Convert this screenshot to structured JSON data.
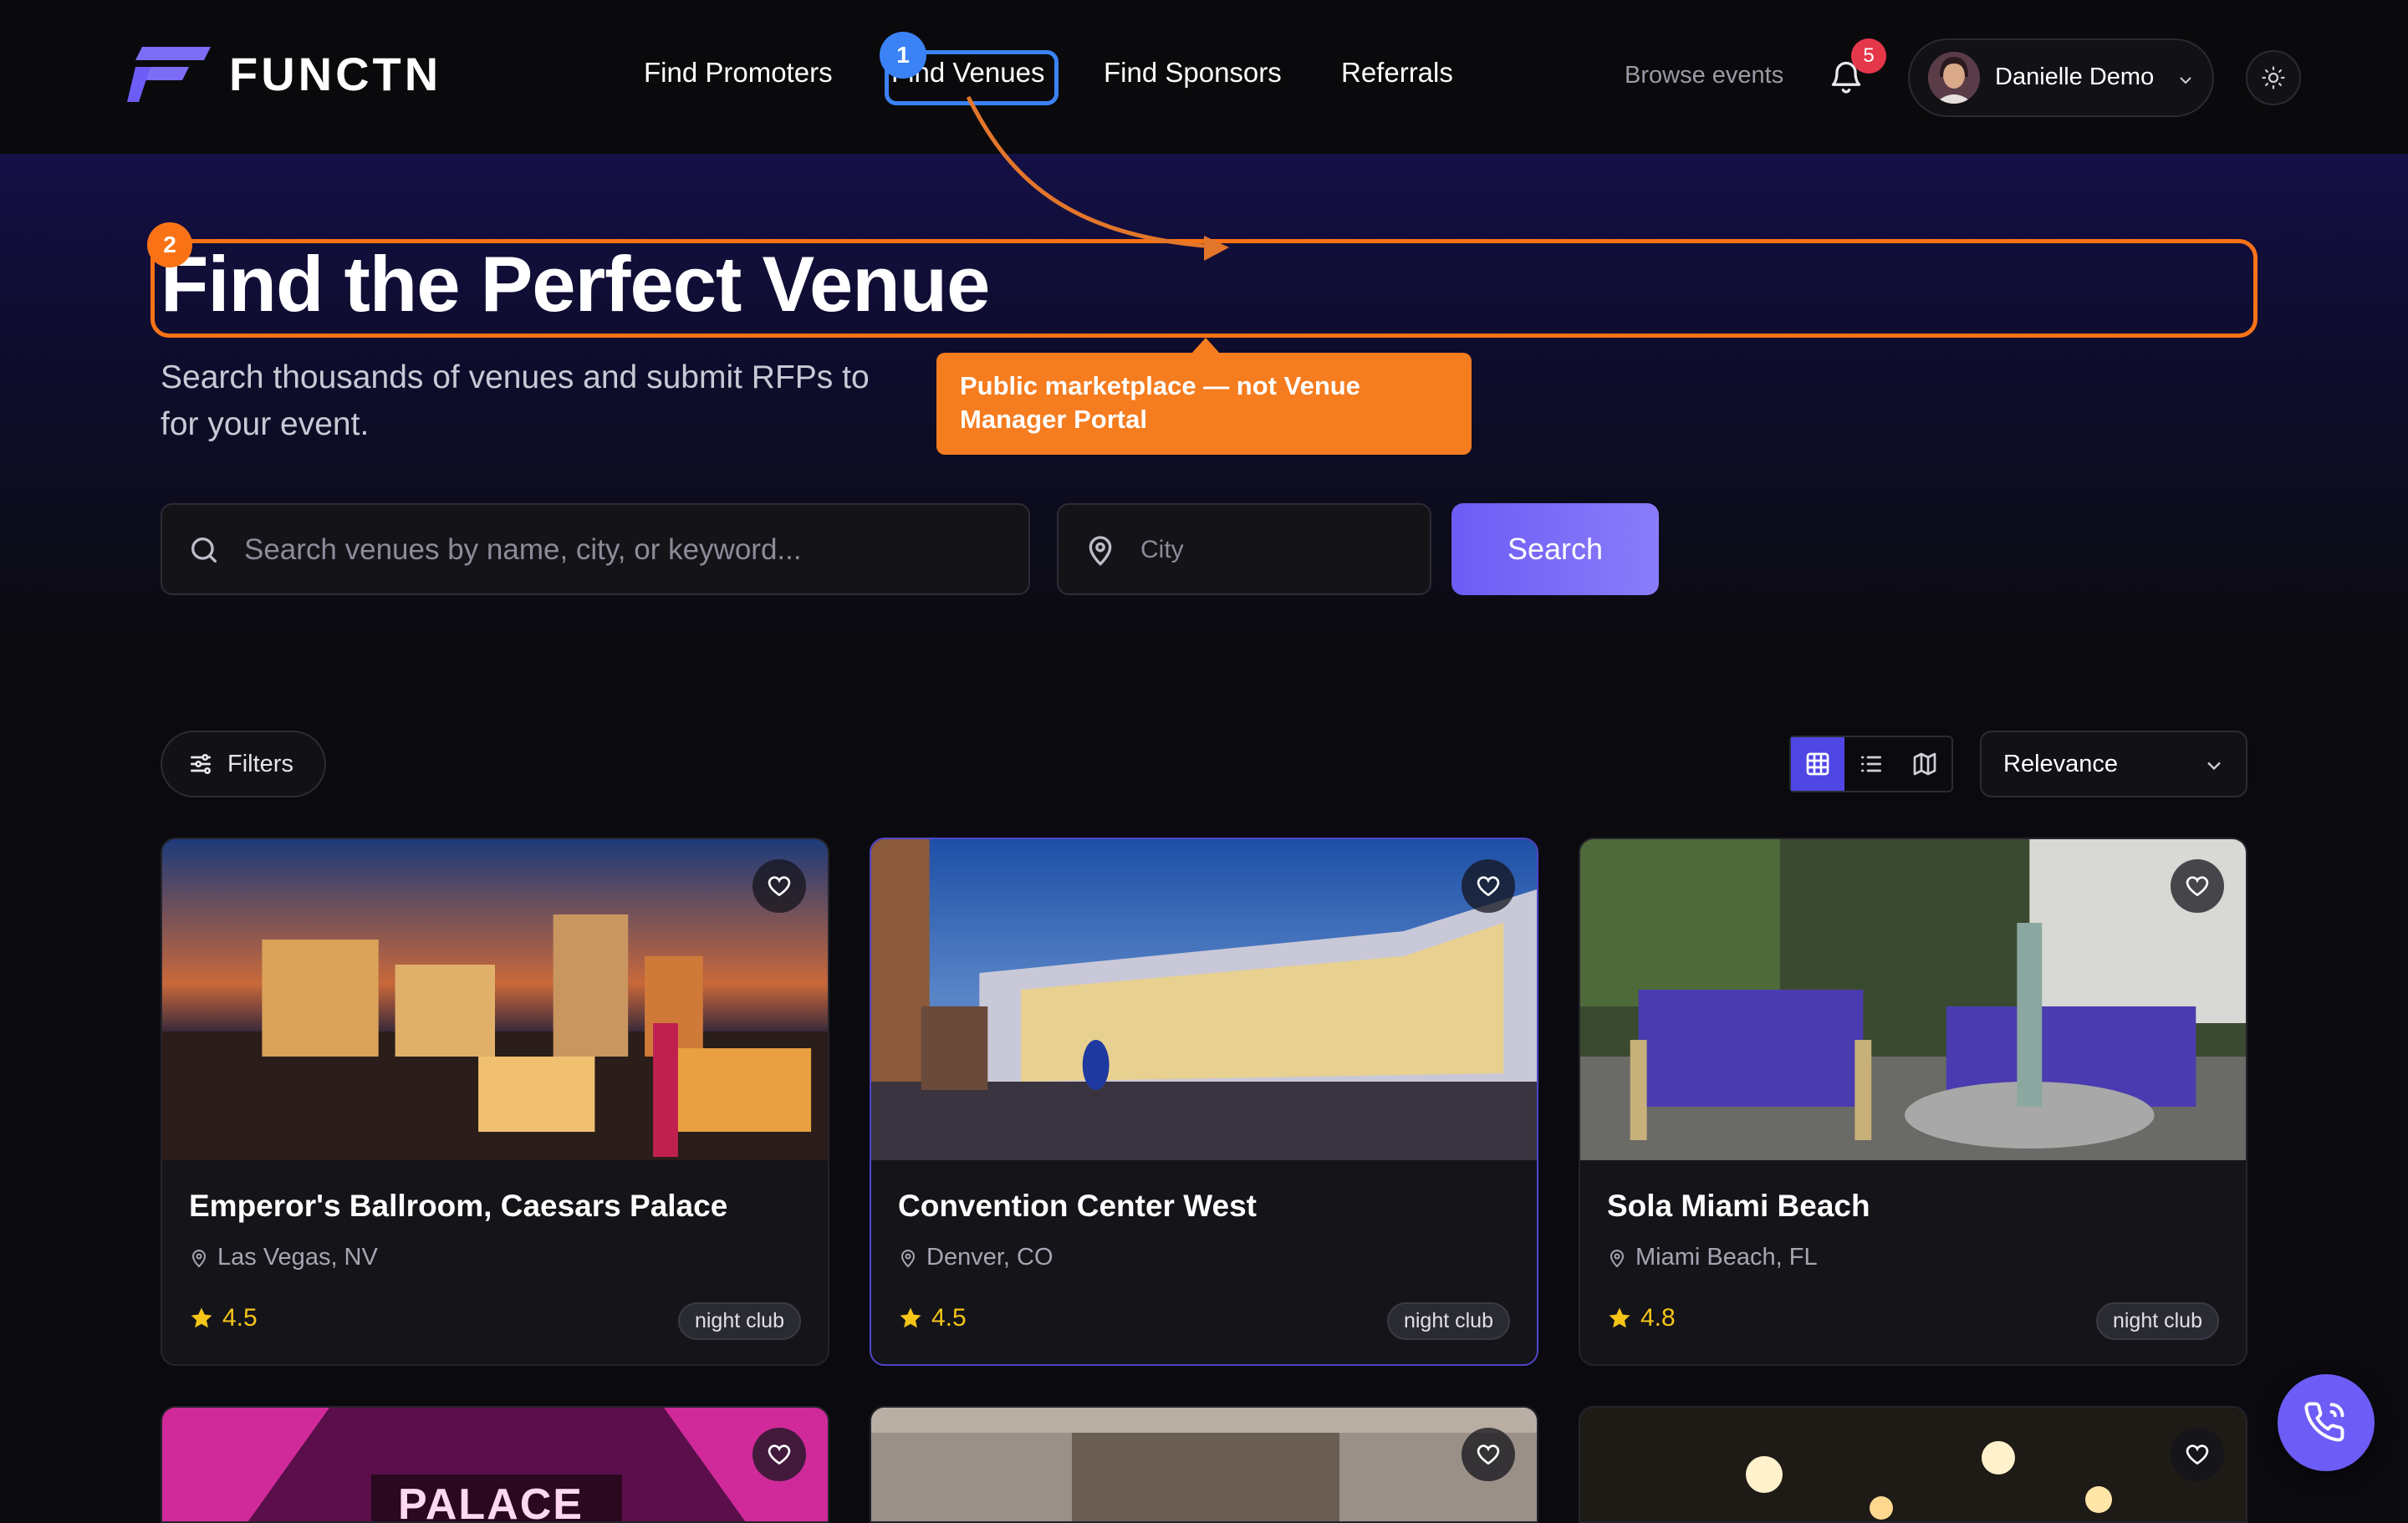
{
  "header": {
    "brand": "FUNCTN",
    "nav": [
      "Find Promoters",
      "Find Venues",
      "Find Sponsors",
      "Referrals"
    ],
    "browse_label": "Browse events",
    "notification_count": "5",
    "user_name": "Danielle Demo"
  },
  "annotations": {
    "step1": "1",
    "step2": "2",
    "tooltip": "Public marketplace — not Venue Manager Portal",
    "box1_color": "#3b82f6",
    "box2_color": "#f97316"
  },
  "hero": {
    "title": "Find the Perfect Venue",
    "subtitle_start": "Search thousands of venues and submit RFPs to",
    "subtitle_end": "for your event."
  },
  "search": {
    "placeholder": "Search venues by name, city, or keyword...",
    "city_placeholder": "City",
    "button_label": "Search"
  },
  "toolbar": {
    "filters_label": "Filters",
    "views": [
      "grid",
      "list",
      "map"
    ],
    "active_view": "grid",
    "sort_label": "Relevance"
  },
  "venues": [
    {
      "name": "Emperor's Ballroom, Caesars Palace",
      "location": "Las Vegas, NV",
      "rating": "4.5",
      "tag": "night club"
    },
    {
      "name": "Convention Center West",
      "location": "Denver, CO",
      "rating": "4.5",
      "tag": "night club"
    },
    {
      "name": "Sola Miami Beach",
      "location": "Miami Beach, FL",
      "rating": "4.8",
      "tag": "night club"
    }
  ],
  "partial_card_text": "PALACE",
  "colors": {
    "accent": "#6d5cf5",
    "badge": "#e5374a",
    "rating": "#f5c518",
    "annotation_orange": "#f57c1f"
  }
}
